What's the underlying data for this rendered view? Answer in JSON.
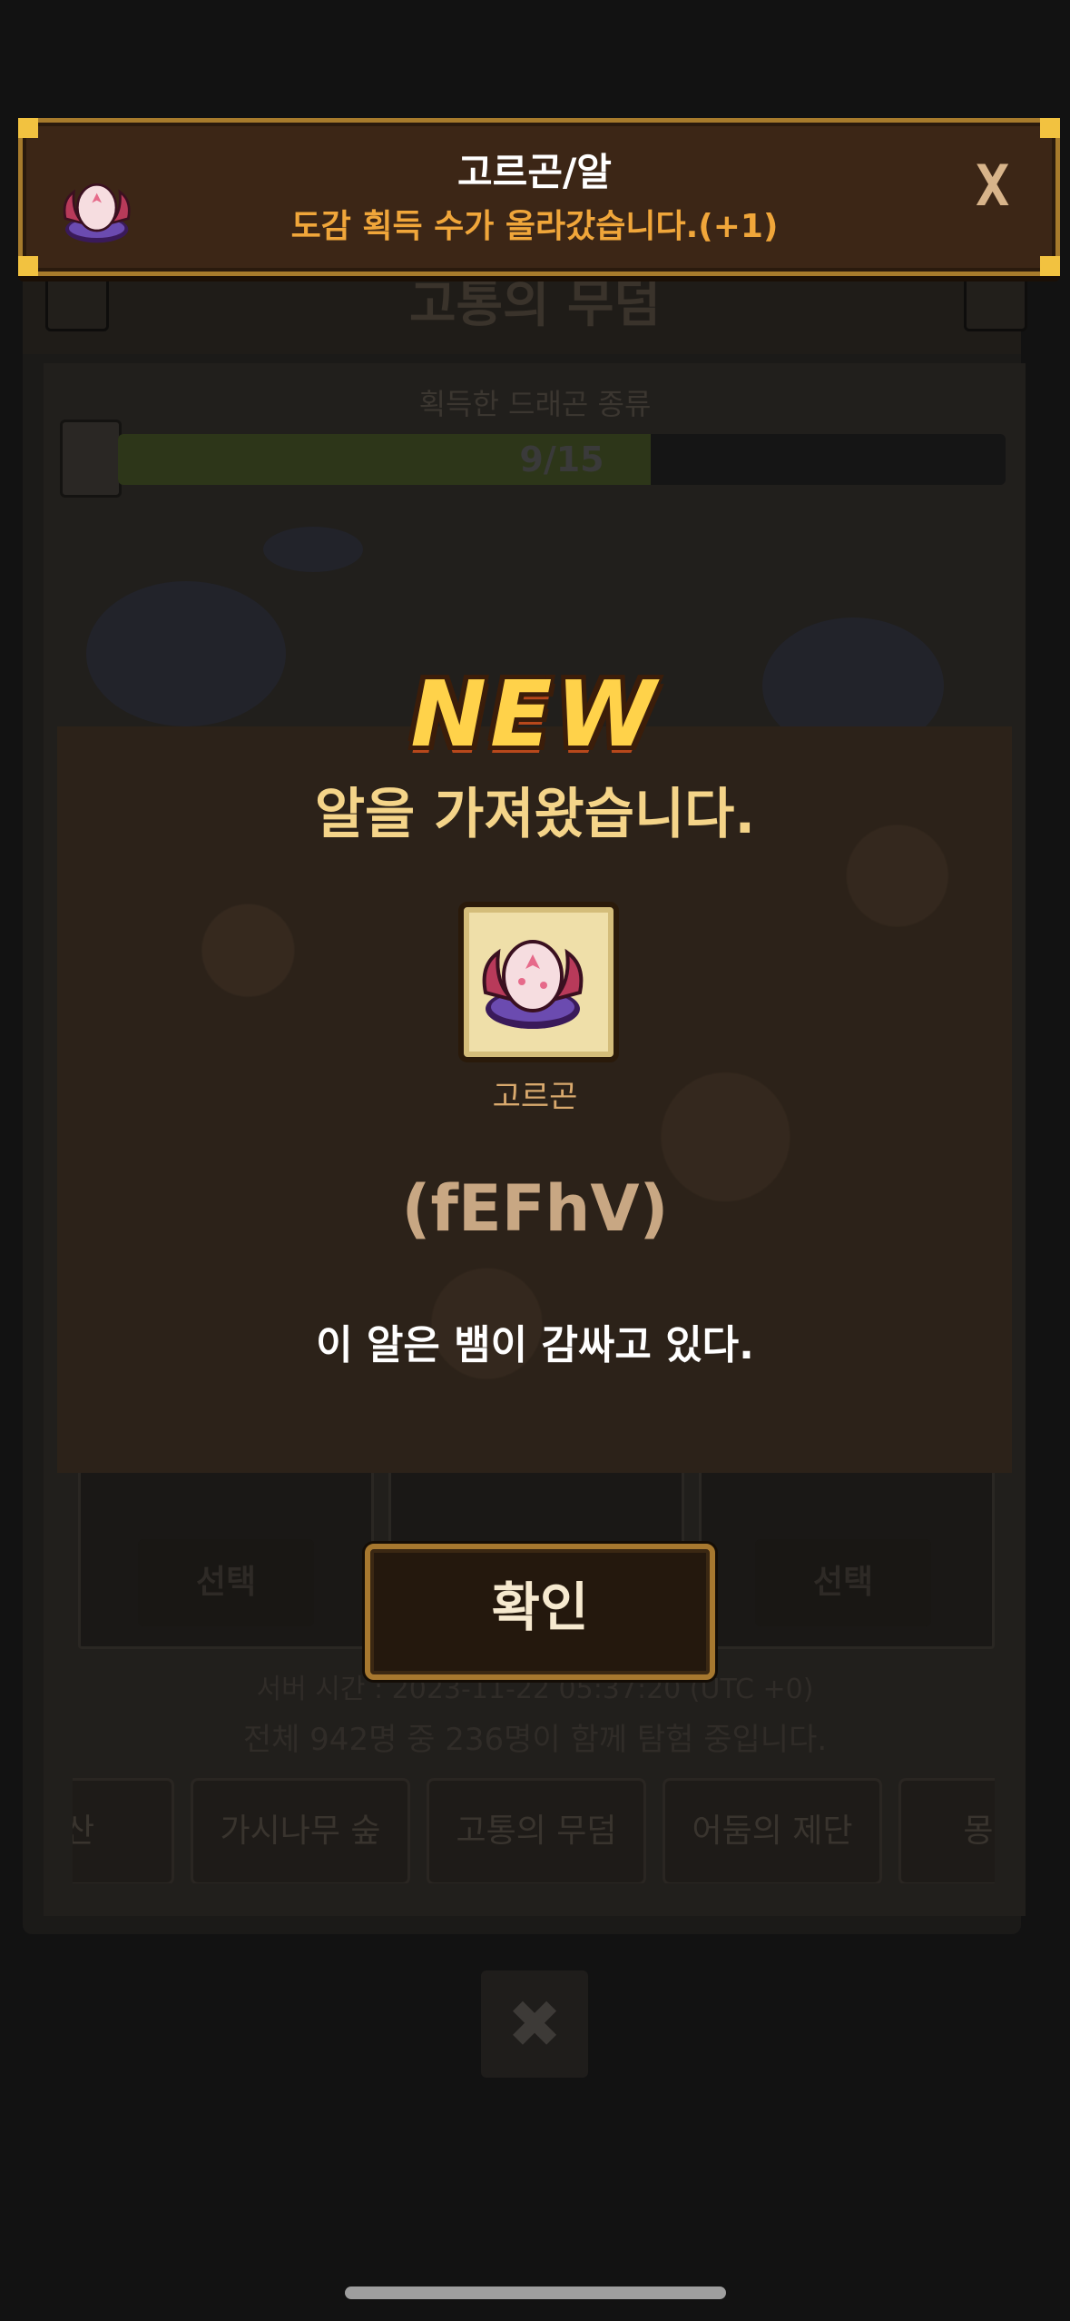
{
  "background": {
    "screen_title": "고통의 무덤",
    "progress_label": "획득한 드래곤 종류",
    "progress_text": "9/15",
    "progress_fraction": 0.6,
    "select_label": "선택",
    "server_time": "서버 시간 : 2023-11-22 05:37:20 (UTC +0)",
    "users_text": "전체 942명 중 236명이 함께 탐험 중입니다.",
    "tabs": [
      "동산",
      "가시나무 숲",
      "고통의 무덤",
      "어둠의 제단",
      "몽환의"
    ],
    "close_label": "✖"
  },
  "banner": {
    "title": "고르곤/알",
    "subtitle": "도감 획득 수가 올라갔습니다.(+1)",
    "close_label": "X"
  },
  "reward": {
    "badge": "NEW",
    "headline": "알을 가져왔습니다.",
    "item_name": "고르곤",
    "code": "(fEFhV)",
    "description": "이 알은 뱀이 감싸고 있다."
  },
  "confirm_label": "확인",
  "colors": {
    "banner_bg": "#3c2616",
    "banner_border": "#a77b2c",
    "headline": "#f4d489",
    "new_badge": "#ffd24a"
  }
}
